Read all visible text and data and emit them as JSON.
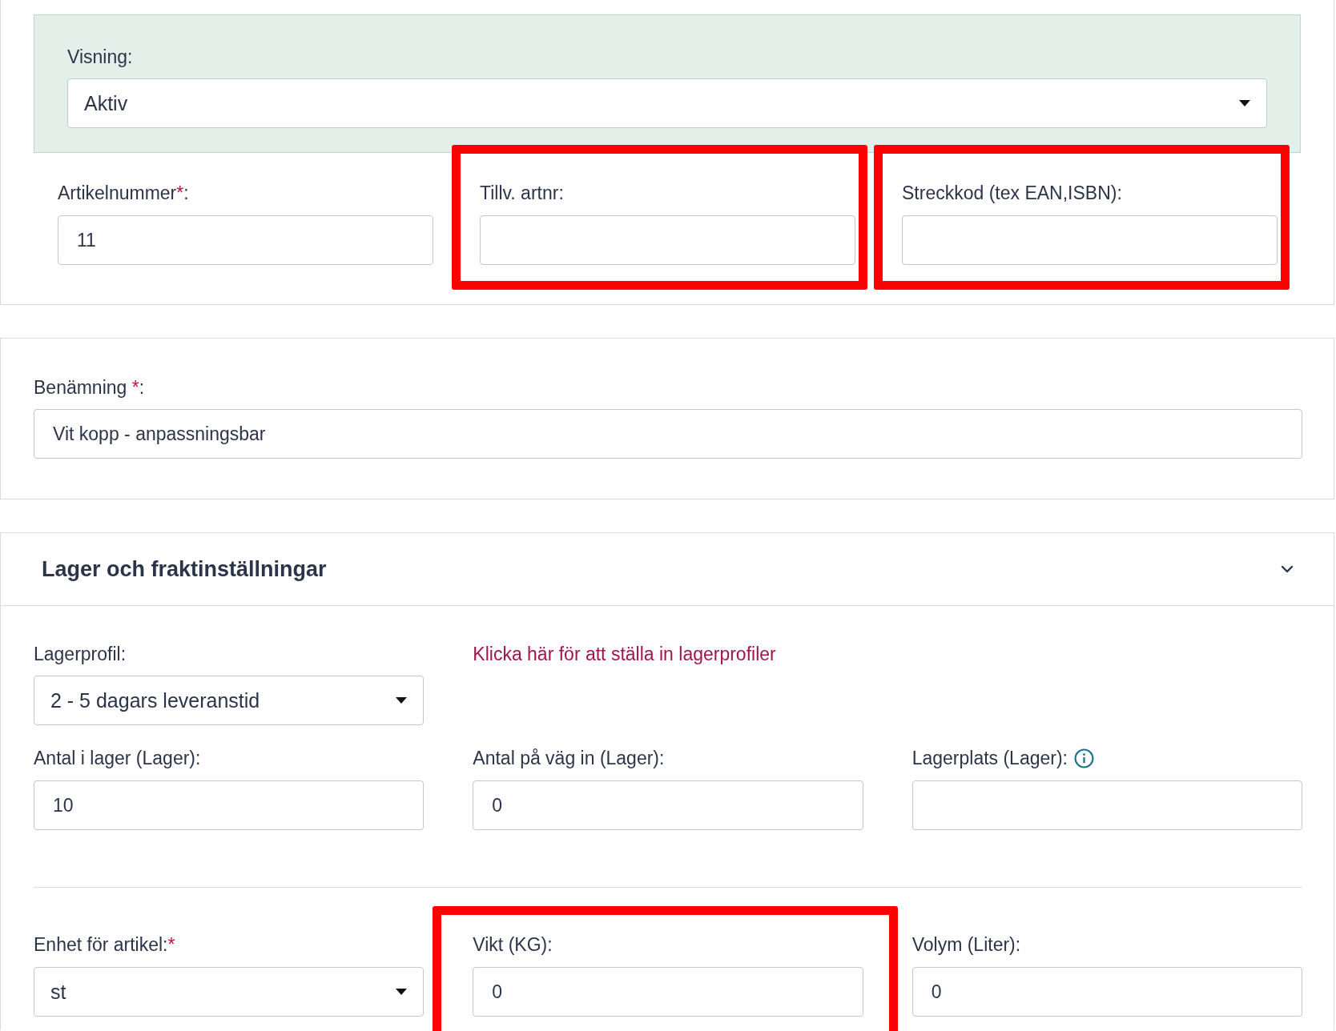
{
  "status_panel": {
    "label": "Visning:",
    "value": "Aktiv"
  },
  "id_fields": [
    {
      "kind": "input",
      "label": "Artikelnummer",
      "mark": "*",
      "label_end": ":",
      "value": "11",
      "highlighted": false
    },
    {
      "kind": "input",
      "label": "Tillv. artnr:",
      "highlighted": true
    },
    {
      "kind": "input",
      "label": "Streckkod (tex EAN,ISBN):",
      "highlighted": true
    }
  ],
  "name_field": {
    "label": "Benämning",
    "mark": "*",
    "label_end": ":",
    "value": "Vit kopp - anpassningsbar"
  },
  "stock_section": {
    "title": "Lager och fraktinställningar",
    "expanded": true,
    "profile_field": {
      "kind": "select",
      "label": "Lagerprofil:",
      "value": "2 - 5 dagars leveranstid",
      "highlighted": false
    },
    "profile_link": "Klicka här för att ställa in lagerprofiler",
    "stock_fields": [
      {
        "kind": "input",
        "label": "Antal i lager (Lager):",
        "value": "10",
        "highlighted": false
      },
      {
        "kind": "input",
        "label": "Antal på väg in (Lager):",
        "value": "0",
        "highlighted": false
      },
      {
        "kind": "input",
        "label": "Lagerplats (Lager):",
        "info": true,
        "highlighted": false
      }
    ],
    "unit_fields": [
      {
        "kind": "select",
        "label": "Enhet för artikel:",
        "mark": "*",
        "value": "st",
        "highlighted": false
      },
      {
        "kind": "input",
        "label": "Vikt (KG):",
        "value": "0",
        "highlighted": true
      },
      {
        "kind": "input",
        "label": "Volym (Liter):",
        "value": "0",
        "highlighted": false
      }
    ]
  }
}
